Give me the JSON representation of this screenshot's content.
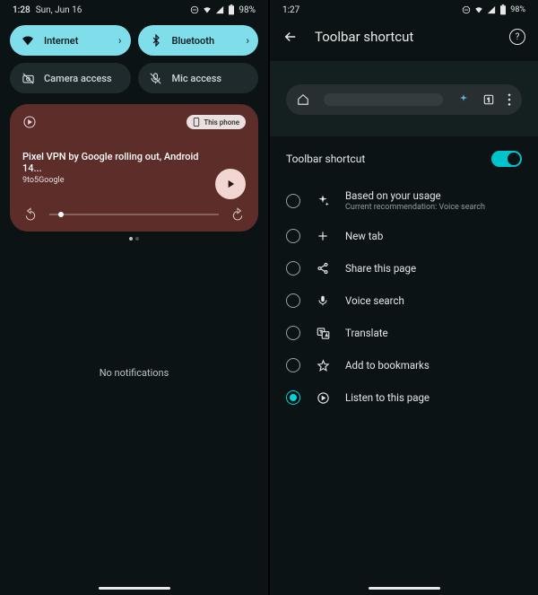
{
  "left": {
    "status": {
      "time": "1:28",
      "date": "Sun, Jun 16",
      "battery": "98%"
    },
    "tiles": [
      {
        "label": "Internet",
        "active": true,
        "icon": "wifi-icon"
      },
      {
        "label": "Bluetooth",
        "active": true,
        "icon": "bluetooth-icon"
      },
      {
        "label": "Camera access",
        "active": false,
        "icon": "camera-off-icon"
      },
      {
        "label": "Mic access",
        "active": false,
        "icon": "mic-off-icon"
      }
    ],
    "media": {
      "app_icon": "play-circle-icon",
      "output_chip": "This phone",
      "title": "Pixel VPN by Google rolling out, Android 14...",
      "source": "9to5Google"
    },
    "no_notifications": "No notifications"
  },
  "right": {
    "status": {
      "time": "1:27",
      "battery": "98%"
    },
    "appbar_title": "Toolbar shortcut",
    "setting_label": "Toolbar shortcut",
    "setting_on": true,
    "options": [
      {
        "icon": "sparkle-icon",
        "label": "Based on your usage",
        "sub": "Current recommendation:  Voice search",
        "selected": false
      },
      {
        "icon": "plus-icon",
        "label": "New tab",
        "selected": false
      },
      {
        "icon": "share-icon",
        "label": "Share this page",
        "selected": false
      },
      {
        "icon": "mic-icon",
        "label": "Voice search",
        "selected": false
      },
      {
        "icon": "translate-icon",
        "label": "Translate",
        "selected": false
      },
      {
        "icon": "star-icon",
        "label": "Add to bookmarks",
        "selected": false
      },
      {
        "icon": "listen-icon",
        "label": "Listen to this page",
        "selected": true
      }
    ]
  }
}
